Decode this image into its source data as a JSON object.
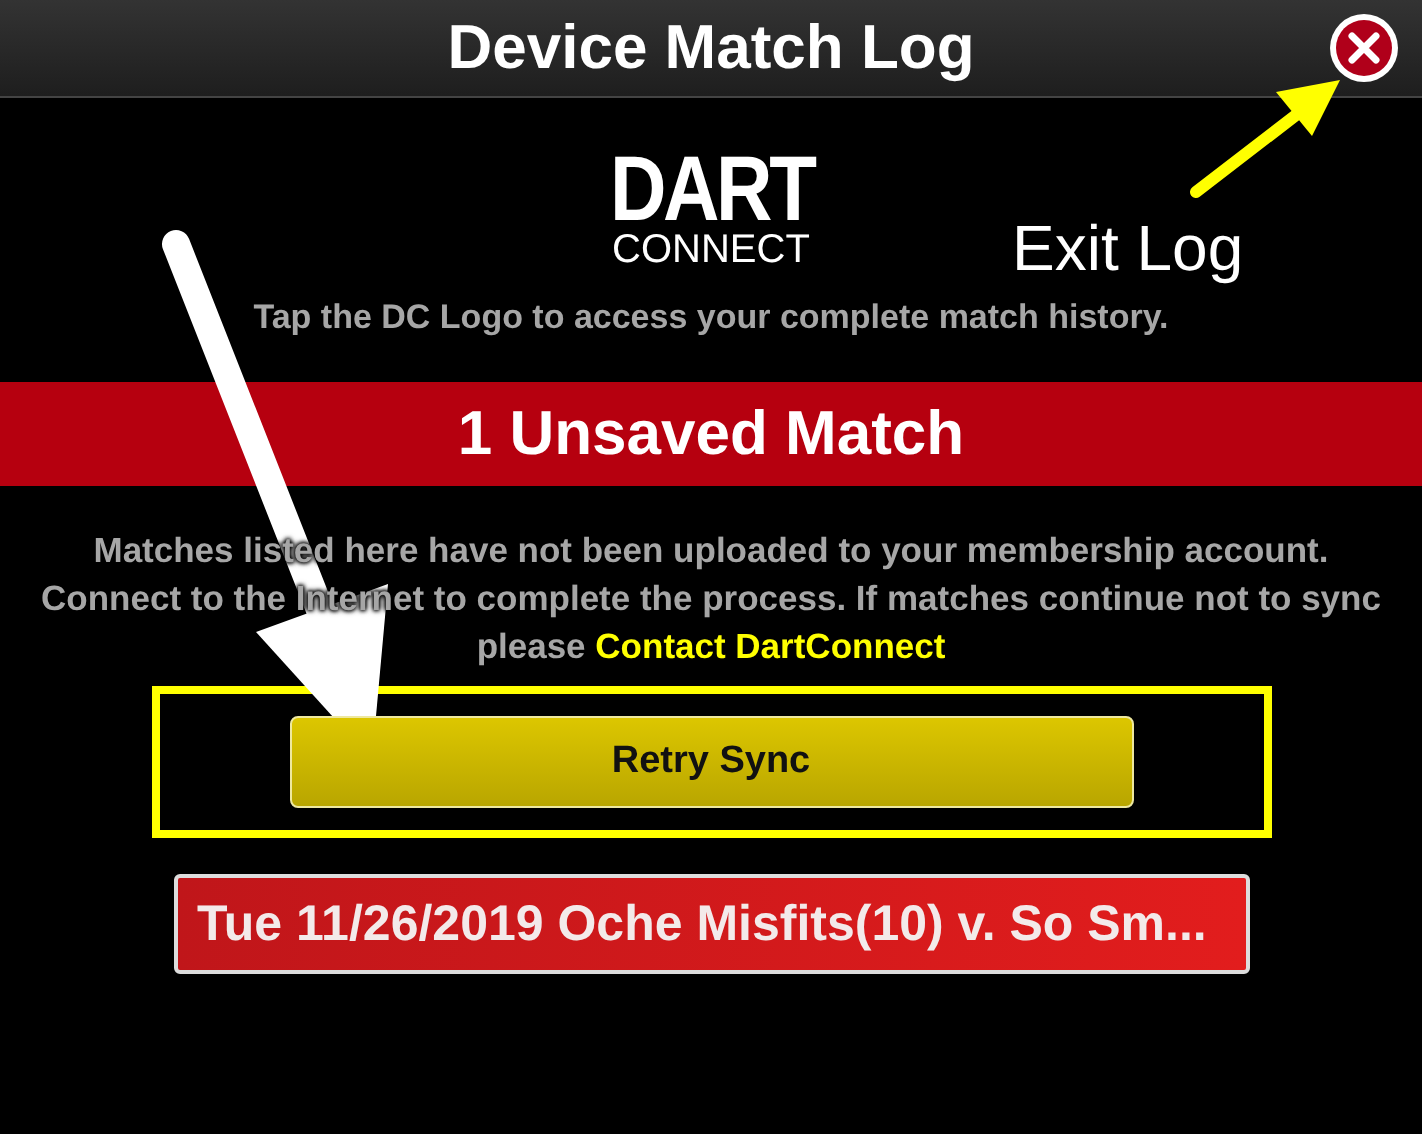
{
  "window": {
    "title": "Device Match Log",
    "close": {
      "kind": "close"
    }
  },
  "logo": {
    "top": "DART",
    "bottom": "CONNECT"
  },
  "hint": "Tap the DC Logo to access your complete match history.",
  "banner": "1 Unsaved Match",
  "message": {
    "text": "Matches listed here have not been uploaded to your membership account. Connect to the Internet to complete the process. If matches continue not to sync please",
    "link": "Contact DartConnect"
  },
  "retry_button": "Retry Sync",
  "matches": [
    {
      "label": "Tue 11/26/2019 Oche Misfits(10) v. So Sm..."
    }
  ],
  "annotations": [
    {
      "kind": "label",
      "text": "Exit Log"
    },
    {
      "kind": "close-arrow",
      "color": "#ffff00"
    },
    {
      "kind": "frame",
      "color": "#ffff00"
    },
    {
      "kind": "retry-arrow",
      "color": "#ffffff"
    }
  ]
}
